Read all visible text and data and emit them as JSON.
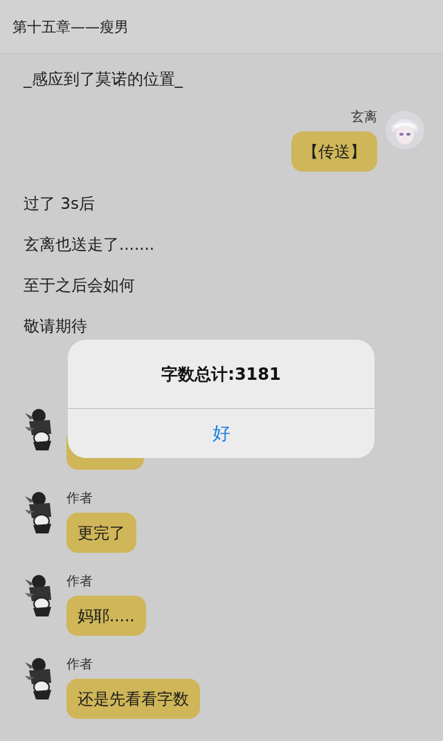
{
  "header": {
    "title": "第十五章——瘦男"
  },
  "feed": [
    {
      "kind": "narration",
      "text": "_感应到了莫诺的位置_"
    },
    {
      "kind": "message_right",
      "name": "玄离",
      "text": "【传送】"
    },
    {
      "kind": "narration",
      "text": "过了 3s后"
    },
    {
      "kind": "narration",
      "text": "玄离也送走了......."
    },
    {
      "kind": "narration",
      "text": "至于之后会如何"
    },
    {
      "kind": "narration",
      "text": "敬请期待"
    },
    {
      "kind": "covered_message"
    },
    {
      "kind": "message_left",
      "name": "作者",
      "text": "更完了"
    },
    {
      "kind": "message_left",
      "name": "作者",
      "text": "妈耶....."
    },
    {
      "kind": "message_left",
      "name": "作者",
      "text": "还是先看看字数"
    }
  ],
  "alert": {
    "title": "字数总计:3181",
    "buttons": [
      "好"
    ]
  }
}
